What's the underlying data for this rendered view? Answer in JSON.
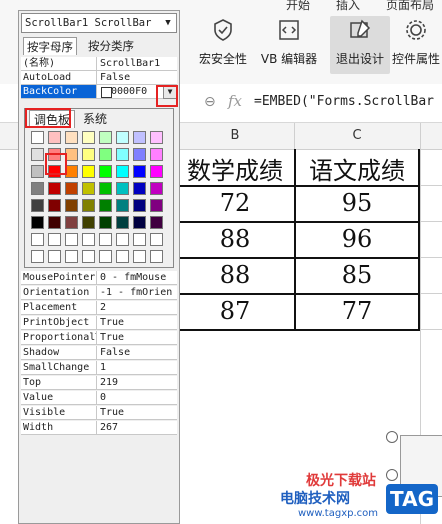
{
  "ribbon": {
    "top_tabs": [
      "开始",
      "插入",
      "页面布局"
    ],
    "buttons": [
      "宏安全性",
      "VB 编辑器",
      "退出设计",
      "控件属性"
    ]
  },
  "formula_bar": {
    "fx_label": "fx",
    "formula": "=EMBED(\"Forms.ScrollBar"
  },
  "columns": [
    "B",
    "C"
  ],
  "table": {
    "headers": [
      "数学成绩",
      "语文成绩"
    ],
    "rows": [
      [
        "72",
        "95"
      ],
      [
        "88",
        "96"
      ],
      [
        "88",
        "85"
      ],
      [
        "87",
        "77"
      ]
    ]
  },
  "properties_panel": {
    "object_selector": "ScrollBar1 ScrollBar",
    "tabs": [
      "按字母序",
      "按分类序"
    ],
    "top_rows": [
      {
        "name": "(名称)",
        "value": "ScrollBar1"
      },
      {
        "name": "AutoLoad",
        "value": "False"
      },
      {
        "name": "BackColor",
        "value": "0000F0"
      }
    ],
    "bottom_rows": [
      {
        "name": "MousePointer",
        "value": "0 - fmMouse"
      },
      {
        "name": "Orientation",
        "value": "-1 - fmOrien"
      },
      {
        "name": "Placement",
        "value": "2"
      },
      {
        "name": "PrintObject",
        "value": "True"
      },
      {
        "name": "ProportionalThumb",
        "value": "True"
      },
      {
        "name": "Shadow",
        "value": "False"
      },
      {
        "name": "SmallChange",
        "value": "1"
      },
      {
        "name": "Top",
        "value": "219"
      },
      {
        "name": "Value",
        "value": "0"
      },
      {
        "name": "Visible",
        "value": "True"
      },
      {
        "name": "Width",
        "value": "267"
      }
    ]
  },
  "palette": {
    "tabs": [
      "调色板",
      "系统"
    ],
    "selected_color": "#ff0000",
    "rows": [
      [
        "#ffffff",
        "#ffc0c0",
        "#ffe0c0",
        "#ffffc0",
        "#c0ffc0",
        "#c0ffff",
        "#c0c0ff",
        "#ffc0ff"
      ],
      [
        "#e0e0e0",
        "#ff8080",
        "#ffc080",
        "#ffff80",
        "#80ff80",
        "#80ffff",
        "#8080ff",
        "#ff80ff"
      ],
      [
        "#c0c0c0",
        "#ff0000",
        "#ff8000",
        "#ffff00",
        "#00ff00",
        "#00ffff",
        "#0000ff",
        "#ff00ff"
      ],
      [
        "#808080",
        "#c00000",
        "#c04000",
        "#c0c000",
        "#00c000",
        "#00c0c0",
        "#0000c0",
        "#c000c0"
      ],
      [
        "#404040",
        "#800000",
        "#804000",
        "#808000",
        "#008000",
        "#008080",
        "#000080",
        "#800080"
      ],
      [
        "#000000",
        "#400000",
        "#804040",
        "#404000",
        "#004000",
        "#004040",
        "#000040",
        "#400040"
      ],
      [
        "#ffffff",
        "#ffffff",
        "#ffffff",
        "#ffffff",
        "#ffffff",
        "#ffffff",
        "#ffffff",
        "#ffffff"
      ],
      [
        "#ffffff",
        "#ffffff",
        "#ffffff",
        "#ffffff",
        "#ffffff",
        "#ffffff",
        "#ffffff",
        "#ffffff"
      ]
    ]
  },
  "watermark": {
    "line1": "极光下载站",
    "line2": "电脑技术网",
    "url": "www.tagxp.com",
    "badge": "TAG"
  }
}
